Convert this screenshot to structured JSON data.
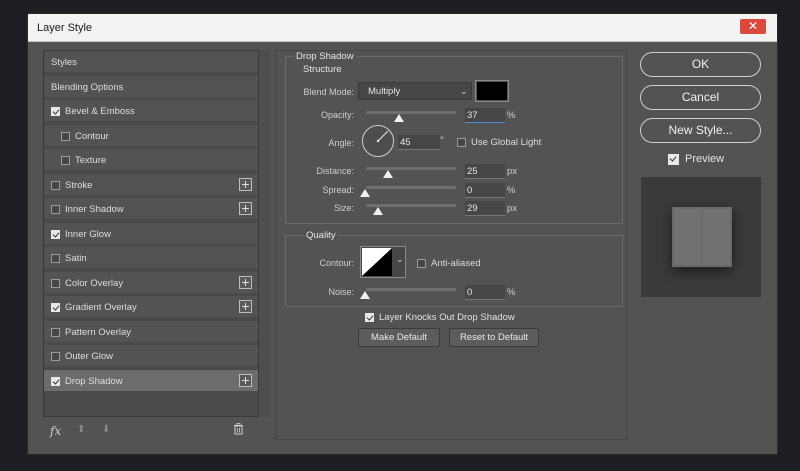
{
  "window": {
    "title": "Layer Style",
    "close_glyph": "✕"
  },
  "styles_list": [
    {
      "label": "Styles",
      "has_checkbox": false,
      "checked": false,
      "plus": false,
      "indent": false
    },
    {
      "label": "Blending Options",
      "has_checkbox": false,
      "checked": false,
      "plus": false,
      "indent": false
    },
    {
      "label": "Bevel & Emboss",
      "has_checkbox": true,
      "checked": true,
      "plus": false,
      "indent": false
    },
    {
      "label": "Contour",
      "has_checkbox": true,
      "checked": false,
      "plus": false,
      "indent": true
    },
    {
      "label": "Texture",
      "has_checkbox": true,
      "checked": false,
      "plus": false,
      "indent": true
    },
    {
      "label": "Stroke",
      "has_checkbox": true,
      "checked": false,
      "plus": true,
      "indent": false
    },
    {
      "label": "Inner Shadow",
      "has_checkbox": true,
      "checked": false,
      "plus": true,
      "indent": false
    },
    {
      "label": "Inner Glow",
      "has_checkbox": true,
      "checked": true,
      "plus": false,
      "indent": false
    },
    {
      "label": "Satin",
      "has_checkbox": true,
      "checked": false,
      "plus": false,
      "indent": false
    },
    {
      "label": "Color Overlay",
      "has_checkbox": true,
      "checked": false,
      "plus": true,
      "indent": false
    },
    {
      "label": "Gradient Overlay",
      "has_checkbox": true,
      "checked": true,
      "plus": true,
      "indent": false
    },
    {
      "label": "Pattern Overlay",
      "has_checkbox": true,
      "checked": false,
      "plus": false,
      "indent": false
    },
    {
      "label": "Outer Glow",
      "has_checkbox": true,
      "checked": false,
      "plus": false,
      "indent": false
    },
    {
      "label": "Drop Shadow",
      "has_checkbox": true,
      "checked": true,
      "plus": true,
      "indent": false,
      "selected": true
    }
  ],
  "list_footer": {
    "fx": "fx",
    "up": "⬆",
    "down": "⬇",
    "trash": "🗑"
  },
  "drop_shadow": {
    "section_title": "Drop Shadow",
    "structure_title": "Structure",
    "blend_mode_label": "Blend Mode:",
    "blend_mode_value": "Multiply",
    "shadow_color": "#000000",
    "opacity_label": "Opacity:",
    "opacity_value": "37",
    "opacity_unit": "%",
    "angle_label": "Angle:",
    "angle_value": "45",
    "angle_unit": "°",
    "use_global_light_label": "Use Global Light",
    "use_global_light": false,
    "distance_label": "Distance:",
    "distance_value": "25",
    "distance_unit": "px",
    "spread_label": "Spread:",
    "spread_value": "0",
    "spread_unit": "%",
    "size_label": "Size:",
    "size_value": "29",
    "size_unit": "px",
    "quality_title": "Quality",
    "contour_label": "Contour:",
    "anti_aliased_label": "Anti-aliased",
    "anti_aliased": false,
    "noise_label": "Noise:",
    "noise_value": "0",
    "noise_unit": "%",
    "knocks_out_label": "Layer Knocks Out Drop Shadow",
    "knocks_out": true,
    "make_default_label": "Make Default",
    "reset_default_label": "Reset to Default"
  },
  "right_panel": {
    "ok_label": "OK",
    "cancel_label": "Cancel",
    "new_style_label": "New Style...",
    "preview_label": "Preview",
    "preview_checked": true
  }
}
